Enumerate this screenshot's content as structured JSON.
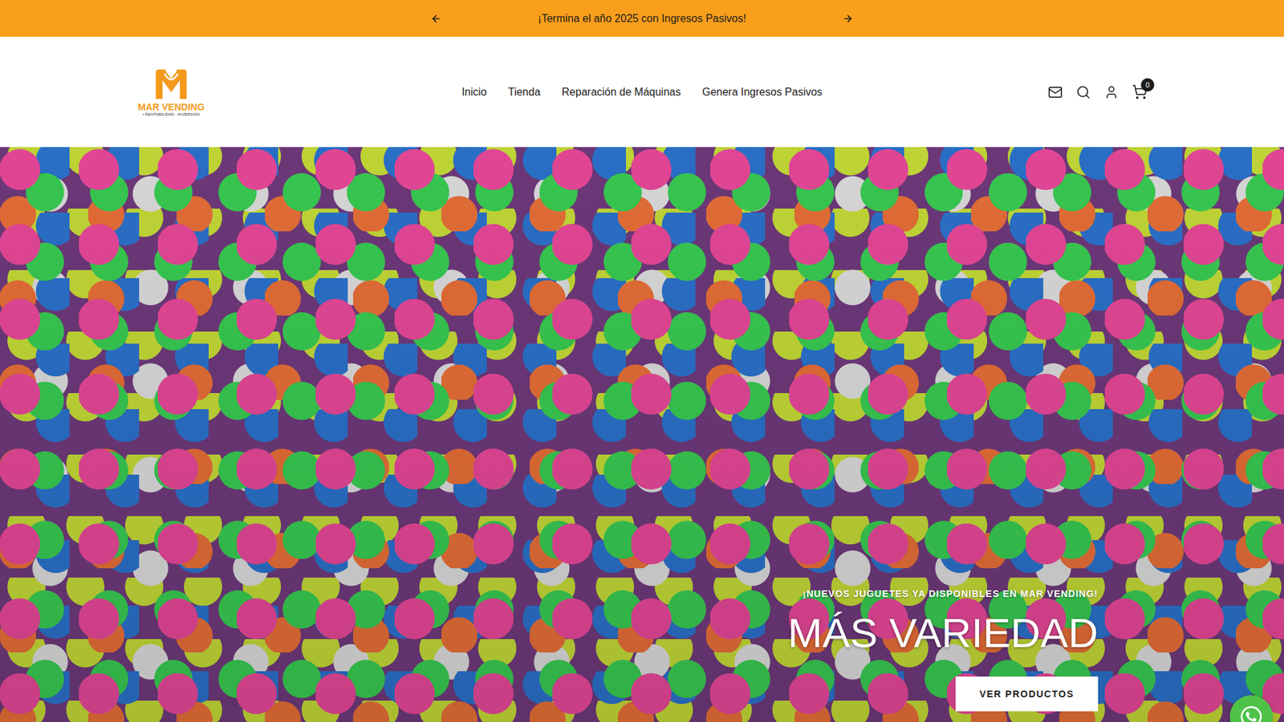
{
  "announcement": {
    "text": "¡Termina el año 2025 con Ingresos Pasivos!"
  },
  "logo": {
    "name": "MAR VENDING",
    "tagline": "• RENTABILIDAD - INVERSION"
  },
  "nav": [
    {
      "label": "Inicio"
    },
    {
      "label": "Tienda"
    },
    {
      "label": "Reparación de Máquinas"
    },
    {
      "label": "Genera Ingresos Pasivos"
    }
  ],
  "cart": {
    "count": "0"
  },
  "hero": {
    "eyebrow": "¡NUEVOS JUGUETES YA DISPONIBLES EN MAR VENDING!",
    "title": "MÁS VARIEDAD",
    "button": "VER PRODUCTOS"
  }
}
